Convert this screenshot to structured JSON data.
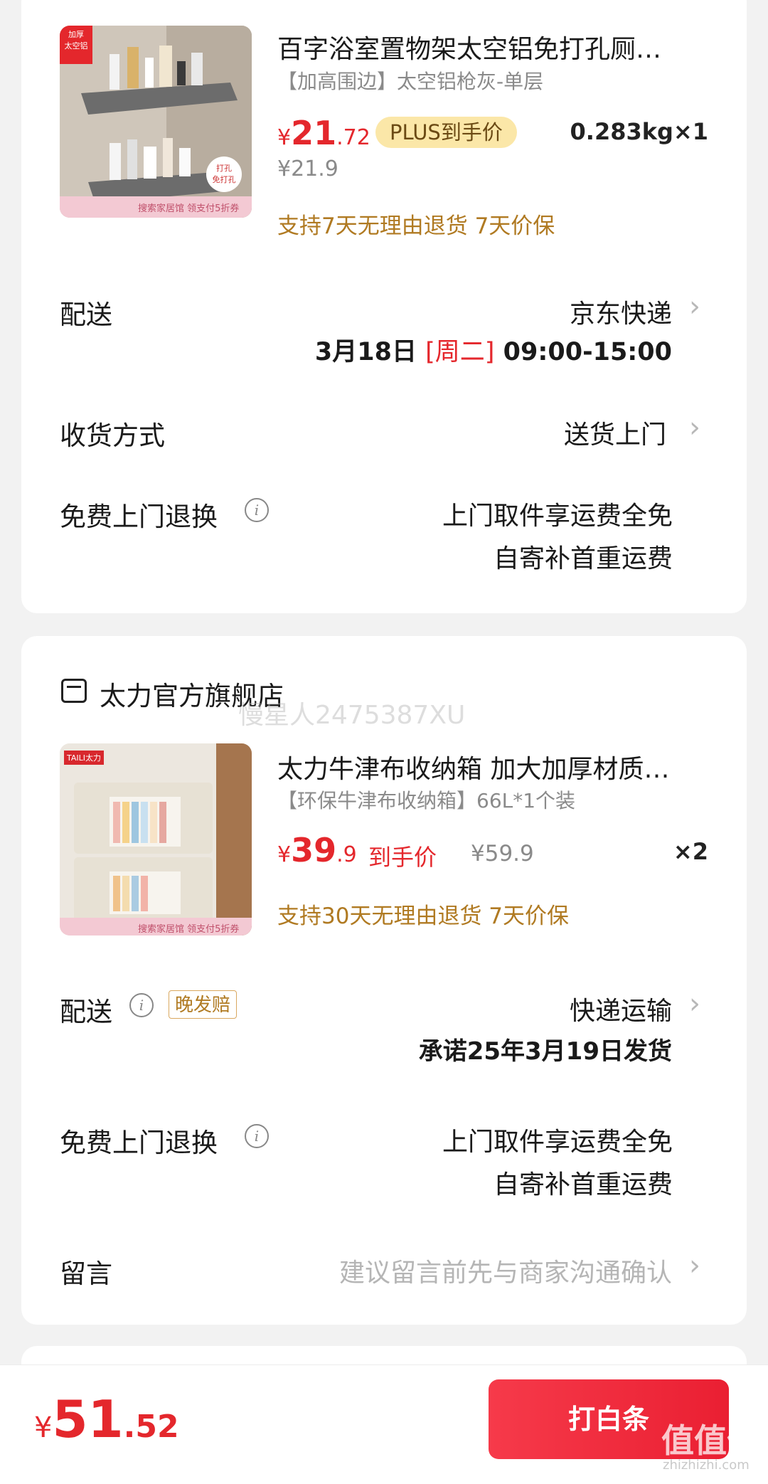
{
  "item1": {
    "title": "百字浴室置物架太空铝免打孔厕…",
    "spec": "【加高围边】太空铝枪灰-单层",
    "price_symbol": "¥",
    "price_int": "21",
    "price_dec": ".72",
    "plus_badge": "PLUS到手价",
    "weight_qty": "0.283kg×1",
    "orig_price": "¥21.9",
    "guarantee": "支持7天无理由退货  7天价保",
    "thumb_badge_top": "加厚\n太空铝",
    "thumb_badge_bottom": "打孔\n免打孔",
    "thumb_banner": "搜索家居馆 领支付5折券"
  },
  "shipping1": {
    "label": "配送",
    "value": "京东快递",
    "date": "3月18日",
    "weekday": "[周二]",
    "time": "09:00-15:00"
  },
  "receive": {
    "label": "收货方式",
    "value": "送货上门"
  },
  "free_return1": {
    "label": "免费上门退换",
    "line1": "上门取件享运费全免",
    "line2": "自寄补首重运费"
  },
  "shop2": {
    "name": "太力官方旗舰店",
    "watermark": "慢星人2475387XU"
  },
  "item2": {
    "title": "太力牛津布收纳箱 加大加厚材质…",
    "spec": "【环保牛津布收纳箱】66L*1个装",
    "price_symbol": "¥",
    "price_int": "39",
    "price_dec": ".9",
    "daoshou": "到手价",
    "orig_price": "¥59.9",
    "qty": "×2",
    "guarantee": "支持30天无理由退货  7天价保",
    "thumb_brand": "TAILI太力",
    "thumb_banner": "搜索家居馆 领支付5折券"
  },
  "shipping2": {
    "label": "配送",
    "late_badge": "晚发赔",
    "value": "快递运输",
    "promise": "承诺25年3月19日发货"
  },
  "free_return2": {
    "label": "免费上门退换",
    "line1": "上门取件享运费全免",
    "line2": "自寄补首重运费"
  },
  "message": {
    "label": "留言",
    "placeholder": "建议留言前先与商家沟通确认"
  },
  "bottom": {
    "symbol": "¥",
    "total_int": "51",
    "total_dec": ".52",
    "pay_button": "打白条",
    "watermark": "值值值",
    "watermark_url": "zhizhizhi.com"
  },
  "colors": {
    "accent": "#e4272c",
    "gold": "#b07a22",
    "plus_bg": "#fbe7a8"
  }
}
